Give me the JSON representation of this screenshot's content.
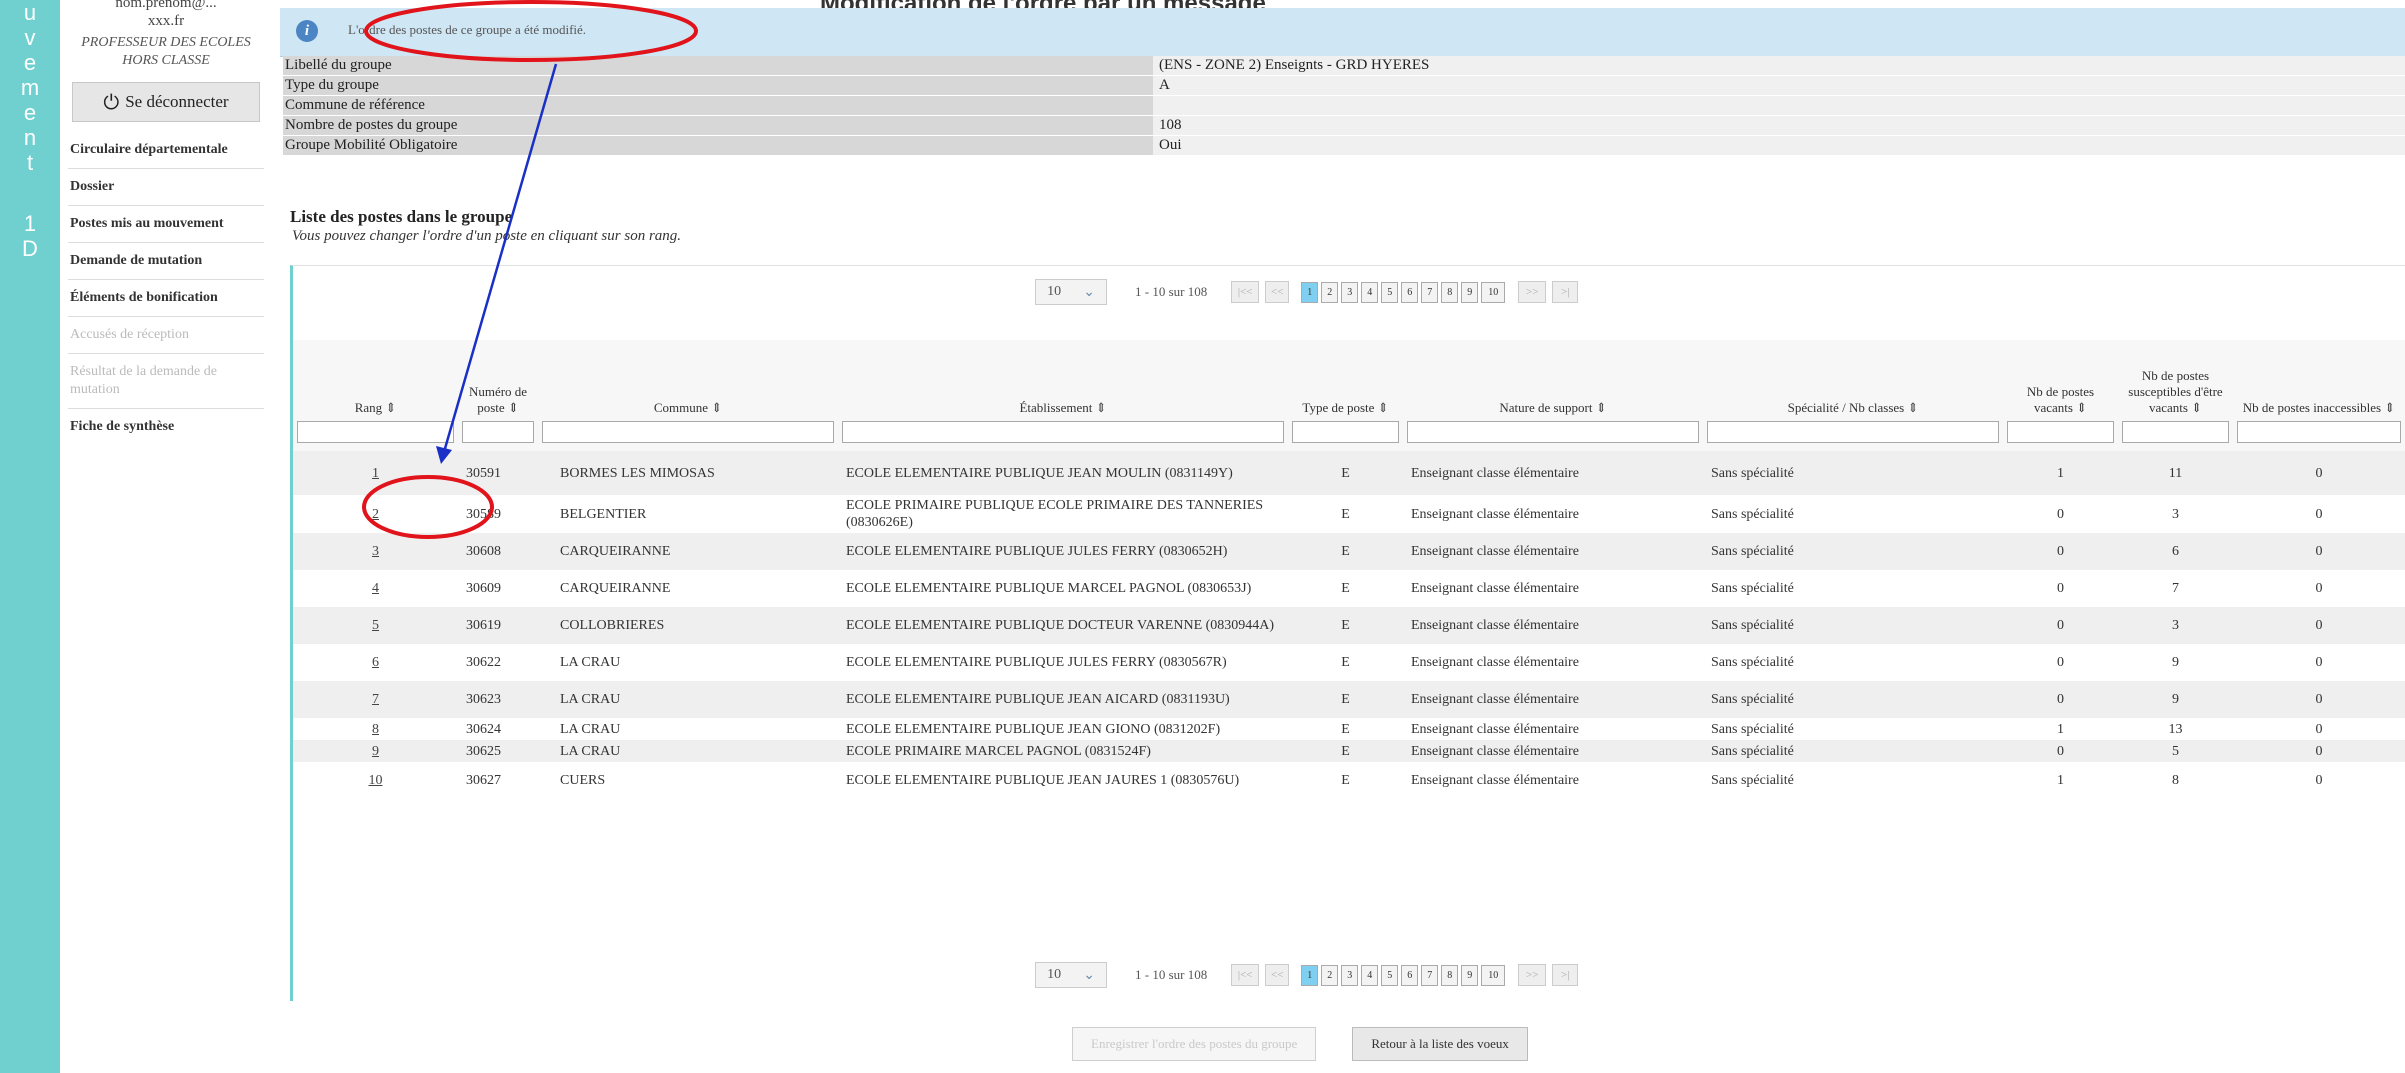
{
  "vertical_letters": [
    "u",
    "v",
    "e",
    "m",
    "e",
    "n",
    "t",
    "",
    "1",
    "D"
  ],
  "user": {
    "email_line1": "nom.prenom@...",
    "email_line2": "xxx.fr",
    "role": "PROFESSEUR DES ECOLES HORS CLASSE"
  },
  "logout_label": "Se déconnecter",
  "menu": [
    {
      "label": "Circulaire départementale",
      "disabled": false
    },
    {
      "label": "Dossier",
      "disabled": false
    },
    {
      "label": "Postes mis au mouvement",
      "disabled": false
    },
    {
      "label": "Demande de mutation",
      "disabled": false
    },
    {
      "label": "Éléments de bonification",
      "disabled": false
    },
    {
      "label": "Accusés de réception",
      "disabled": true
    },
    {
      "label": "Résultat de la demande de mutation",
      "disabled": true
    },
    {
      "label": "Fiche de synthèse",
      "disabled": false
    }
  ],
  "top_cut_title": "Modification de l'ordre par un message",
  "info_message": "L'ordre des postes de ce groupe a été modifié.",
  "group_fields": [
    {
      "label": "Libellé du groupe",
      "value": "(ENS - ZONE 2) Enseignts - GRD HYERES"
    },
    {
      "label": "Type du groupe",
      "value": "A"
    },
    {
      "label": "Commune de référence",
      "value": ""
    },
    {
      "label": "Nombre de postes du groupe",
      "value": "108"
    },
    {
      "label": "Groupe Mobilité Obligatoire",
      "value": "Oui"
    }
  ],
  "liste_title": "Liste des postes dans le groupe",
  "liste_subtitle": "Vous pouvez changer l'ordre d'un poste en cliquant sur son rang.",
  "pager": {
    "page_size": "10",
    "range_text": "1 - 10 sur 108",
    "first": "|<<",
    "prev": "<<",
    "pages": [
      "1",
      "2",
      "3",
      "4",
      "5",
      "6",
      "7",
      "8",
      "9",
      "10"
    ],
    "current": "1",
    "next": ">>",
    "last": ">|"
  },
  "columns": [
    "Rang ⇕",
    "Numéro de poste ⇕",
    "Commune ⇕",
    "Établissement ⇕",
    "Type de poste ⇕",
    "Nature de support ⇕",
    "Spécialité / Nb classes ⇕",
    "Nb de postes vacants ⇕",
    "Nb de postes susceptibles d'être vacants ⇕",
    "Nb de postes inaccessibles ⇕"
  ],
  "rows": [
    [
      "1",
      "30591",
      "BORMES LES MIMOSAS",
      "ECOLE ELEMENTAIRE PUBLIQUE JEAN MOULIN (0831149Y)",
      "E",
      "Enseignant classe élémentaire",
      "Sans spécialité",
      "1",
      "11",
      "0"
    ],
    [
      "2",
      "30589",
      "BELGENTIER",
      "ECOLE PRIMAIRE PUBLIQUE ECOLE PRIMAIRE DES TANNERIES (0830626E)",
      "E",
      "Enseignant classe élémentaire",
      "Sans spécialité",
      "0",
      "3",
      "0"
    ],
    [
      "3",
      "30608",
      "CARQUEIRANNE",
      "ECOLE ELEMENTAIRE PUBLIQUE JULES FERRY (0830652H)",
      "E",
      "Enseignant classe élémentaire",
      "Sans spécialité",
      "0",
      "6",
      "0"
    ],
    [
      "4",
      "30609",
      "CARQUEIRANNE",
      "ECOLE ELEMENTAIRE PUBLIQUE MARCEL PAGNOL (0830653J)",
      "E",
      "Enseignant classe élémentaire",
      "Sans spécialité",
      "0",
      "7",
      "0"
    ],
    [
      "5",
      "30619",
      "COLLOBRIERES",
      "ECOLE ELEMENTAIRE PUBLIQUE DOCTEUR VARENNE (0830944A)",
      "E",
      "Enseignant classe élémentaire",
      "Sans spécialité",
      "0",
      "3",
      "0"
    ],
    [
      "6",
      "30622",
      "LA CRAU",
      "ECOLE ELEMENTAIRE PUBLIQUE JULES FERRY (0830567R)",
      "E",
      "Enseignant classe élémentaire",
      "Sans spécialité",
      "0",
      "9",
      "0"
    ],
    [
      "7",
      "30623",
      "LA CRAU",
      "ECOLE ELEMENTAIRE PUBLIQUE JEAN AICARD (0831193U)",
      "E",
      "Enseignant classe élémentaire",
      "Sans spécialité",
      "0",
      "9",
      "0"
    ],
    [
      "8",
      "30624",
      "LA CRAU",
      "ECOLE ELEMENTAIRE PUBLIQUE JEAN GIONO (0831202F)",
      "E",
      "Enseignant classe élémentaire",
      "Sans spécialité",
      "1",
      "13",
      "0"
    ],
    [
      "9",
      "30625",
      "LA CRAU",
      "ECOLE PRIMAIRE MARCEL PAGNOL (0831524F)",
      "E",
      "Enseignant classe élémentaire",
      "Sans spécialité",
      "0",
      "5",
      "0"
    ],
    [
      "10",
      "30627",
      "CUERS",
      "ECOLE ELEMENTAIRE PUBLIQUE JEAN JAURES 1 (0830576U)",
      "E",
      "Enseignant classe élémentaire",
      "Sans spécialité",
      "1",
      "8",
      "0"
    ]
  ],
  "buttons": {
    "save_order": "Enregistrer l'ordre des postes du groupe",
    "back": "Retour à la liste des voeux"
  },
  "annotation_color": "#e0141a",
  "arrow_color": "#1a2fc6"
}
